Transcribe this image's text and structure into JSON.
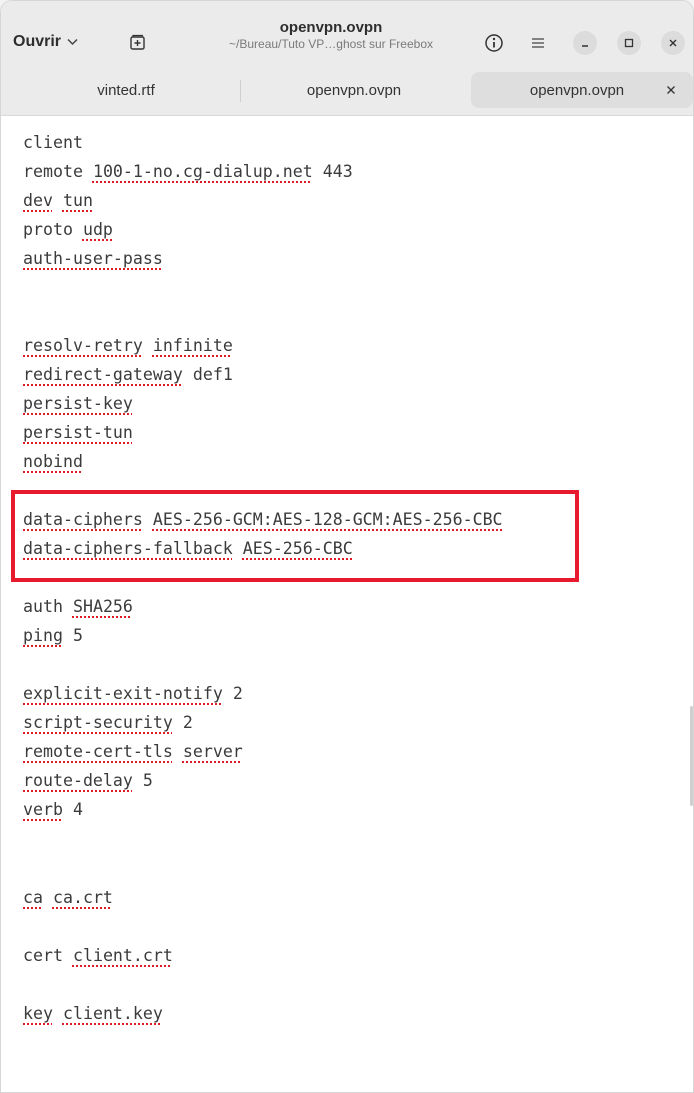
{
  "header": {
    "open_label": "Ouvrir",
    "title": "openvpn.ovpn",
    "subtitle": "~/Bureau/Tuto VP…ghost sur Freebox"
  },
  "tabs": [
    {
      "label": "vinted.rtf"
    },
    {
      "label": "openvpn.ovpn"
    },
    {
      "label": "openvpn.ovpn"
    }
  ],
  "colors": {
    "highlight_box": "#e81a2d",
    "spell_underline": "#e01b24"
  },
  "editor": {
    "lines": [
      [
        "client"
      ],
      [
        "remote",
        "100-1-no.cg-dialup.net",
        "443"
      ],
      [
        "dev",
        "tun"
      ],
      [
        "proto",
        "udp"
      ],
      [
        "auth-user-pass"
      ],
      [
        "resolv-retry",
        "infinite"
      ],
      [
        "redirect-gateway",
        "def1"
      ],
      [
        "persist-key"
      ],
      [
        "persist-tun"
      ],
      [
        "nobind"
      ],
      [
        "data-ciphers",
        "AES-256-GCM:AES-128-GCM:AES-256-CBC"
      ],
      [
        "data-ciphers-fallback",
        "AES-256-CBC"
      ],
      [
        "auth",
        "SHA256"
      ],
      [
        "ping",
        "5"
      ],
      [
        "explicit-exit-notify",
        "2"
      ],
      [
        "script-security",
        "2"
      ],
      [
        "remote-cert-tls",
        "server"
      ],
      [
        "route-delay",
        "5"
      ],
      [
        "verb",
        "4"
      ],
      [
        "ca",
        "ca.crt"
      ],
      [
        "cert",
        "client.crt"
      ],
      [
        "key",
        "client.key"
      ]
    ]
  }
}
